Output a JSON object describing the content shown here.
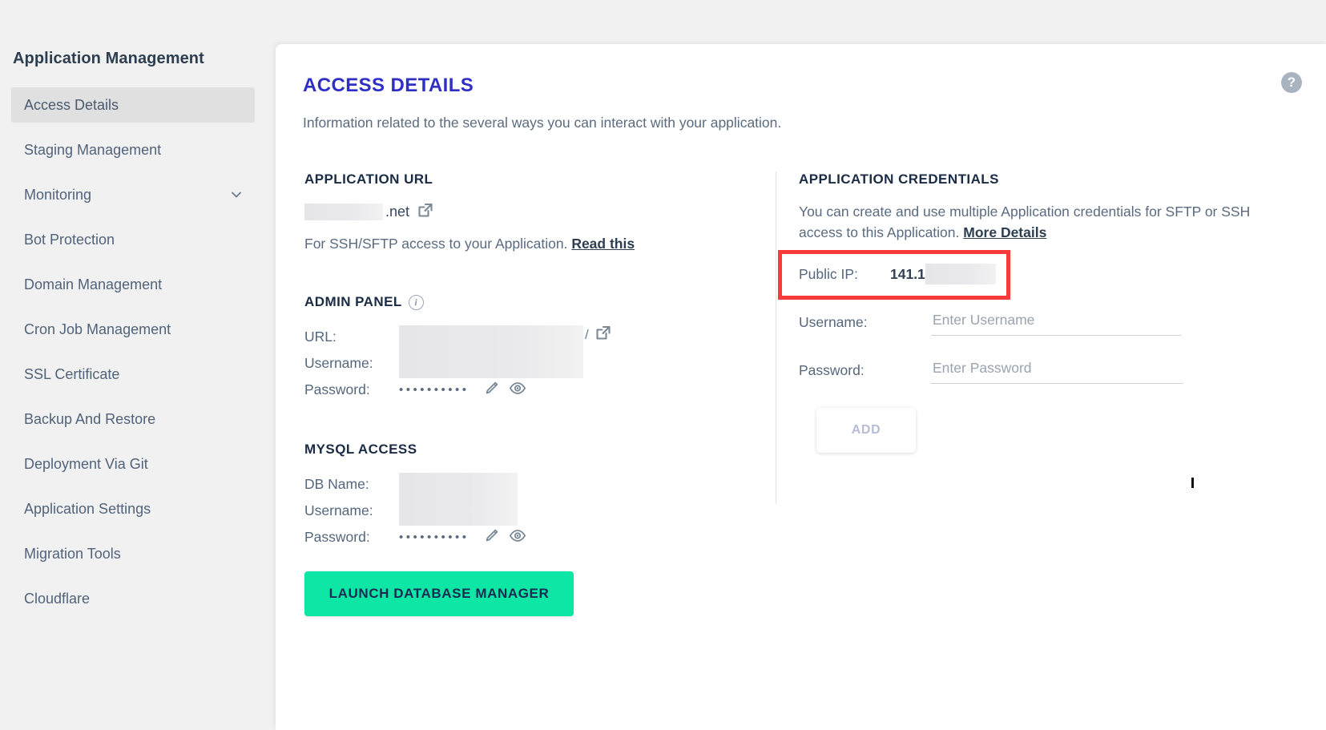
{
  "sidebar": {
    "title": "Application Management",
    "items": [
      {
        "label": "Access Details",
        "active": true,
        "expandable": false
      },
      {
        "label": "Staging Management",
        "active": false,
        "expandable": false
      },
      {
        "label": "Monitoring",
        "active": false,
        "expandable": true
      },
      {
        "label": "Bot Protection",
        "active": false,
        "expandable": false
      },
      {
        "label": "Domain Management",
        "active": false,
        "expandable": false
      },
      {
        "label": "Cron Job Management",
        "active": false,
        "expandable": false
      },
      {
        "label": "SSL Certificate",
        "active": false,
        "expandable": false
      },
      {
        "label": "Backup And Restore",
        "active": false,
        "expandable": false
      },
      {
        "label": "Deployment Via Git",
        "active": false,
        "expandable": false
      },
      {
        "label": "Application Settings",
        "active": false,
        "expandable": false
      },
      {
        "label": "Migration Tools",
        "active": false,
        "expandable": false
      },
      {
        "label": "Cloudflare",
        "active": false,
        "expandable": false
      }
    ]
  },
  "page": {
    "title": "ACCESS DETAILS",
    "subtitle": "Information related to the several ways you can interact with your application.",
    "help_icon": "help-circle-icon",
    "help_glyph": "?"
  },
  "application_url": {
    "heading": "APPLICATION URL",
    "value_redacted": true,
    "value_suffix": ".net",
    "external_link_icon": "external-link-icon",
    "note_text": "For SSH/SFTP access to your Application.",
    "note_link": "Read this"
  },
  "admin_panel": {
    "heading": "ADMIN PANEL",
    "info_icon": "info-circle-icon",
    "rows": [
      {
        "label": "URL:",
        "value": "",
        "redacted": true
      },
      {
        "label": "Username:",
        "value": "",
        "redacted": true
      },
      {
        "label": "Password:",
        "value": "••••••••••",
        "redacted": false
      }
    ],
    "external_link_icon": "external-link-icon",
    "url_trailing_slash": "/",
    "edit_icon": "pencil-icon",
    "reveal_icon": "eye-icon"
  },
  "mysql_access": {
    "heading": "MYSQL ACCESS",
    "rows": [
      {
        "label": "DB Name:",
        "value": "",
        "redacted": true
      },
      {
        "label": "Username:",
        "value": "",
        "redacted": true
      },
      {
        "label": "Password:",
        "value": "••••••••••",
        "redacted": false
      }
    ],
    "edit_icon": "pencil-icon",
    "reveal_icon": "eye-icon",
    "launch_button": "LAUNCH DATABASE MANAGER"
  },
  "application_credentials": {
    "heading": "APPLICATION CREDENTIALS",
    "description": "You can create and use multiple Application credentials for SFTP or SSH access to this Application.",
    "description_link": "More Details",
    "public_ip_label": "Public IP:",
    "public_ip_value": "141.1",
    "public_ip_redacted": true,
    "username_label": "Username:",
    "username_value": "",
    "username_placeholder": "Enter Username",
    "password_label": "Password:",
    "password_value": "",
    "password_placeholder": "Enter Password",
    "add_button": "ADD",
    "add_button_disabled": true
  },
  "colors": {
    "accent_blue": "#2f2fc8",
    "green_button": "#0de6a4",
    "annotation_red": "#f93a3a",
    "sidebar_bg": "#f1f1f1",
    "active_item_bg": "#e0e0e0",
    "text_dark": "#1a2b45",
    "text_muted": "#5a6b80"
  }
}
